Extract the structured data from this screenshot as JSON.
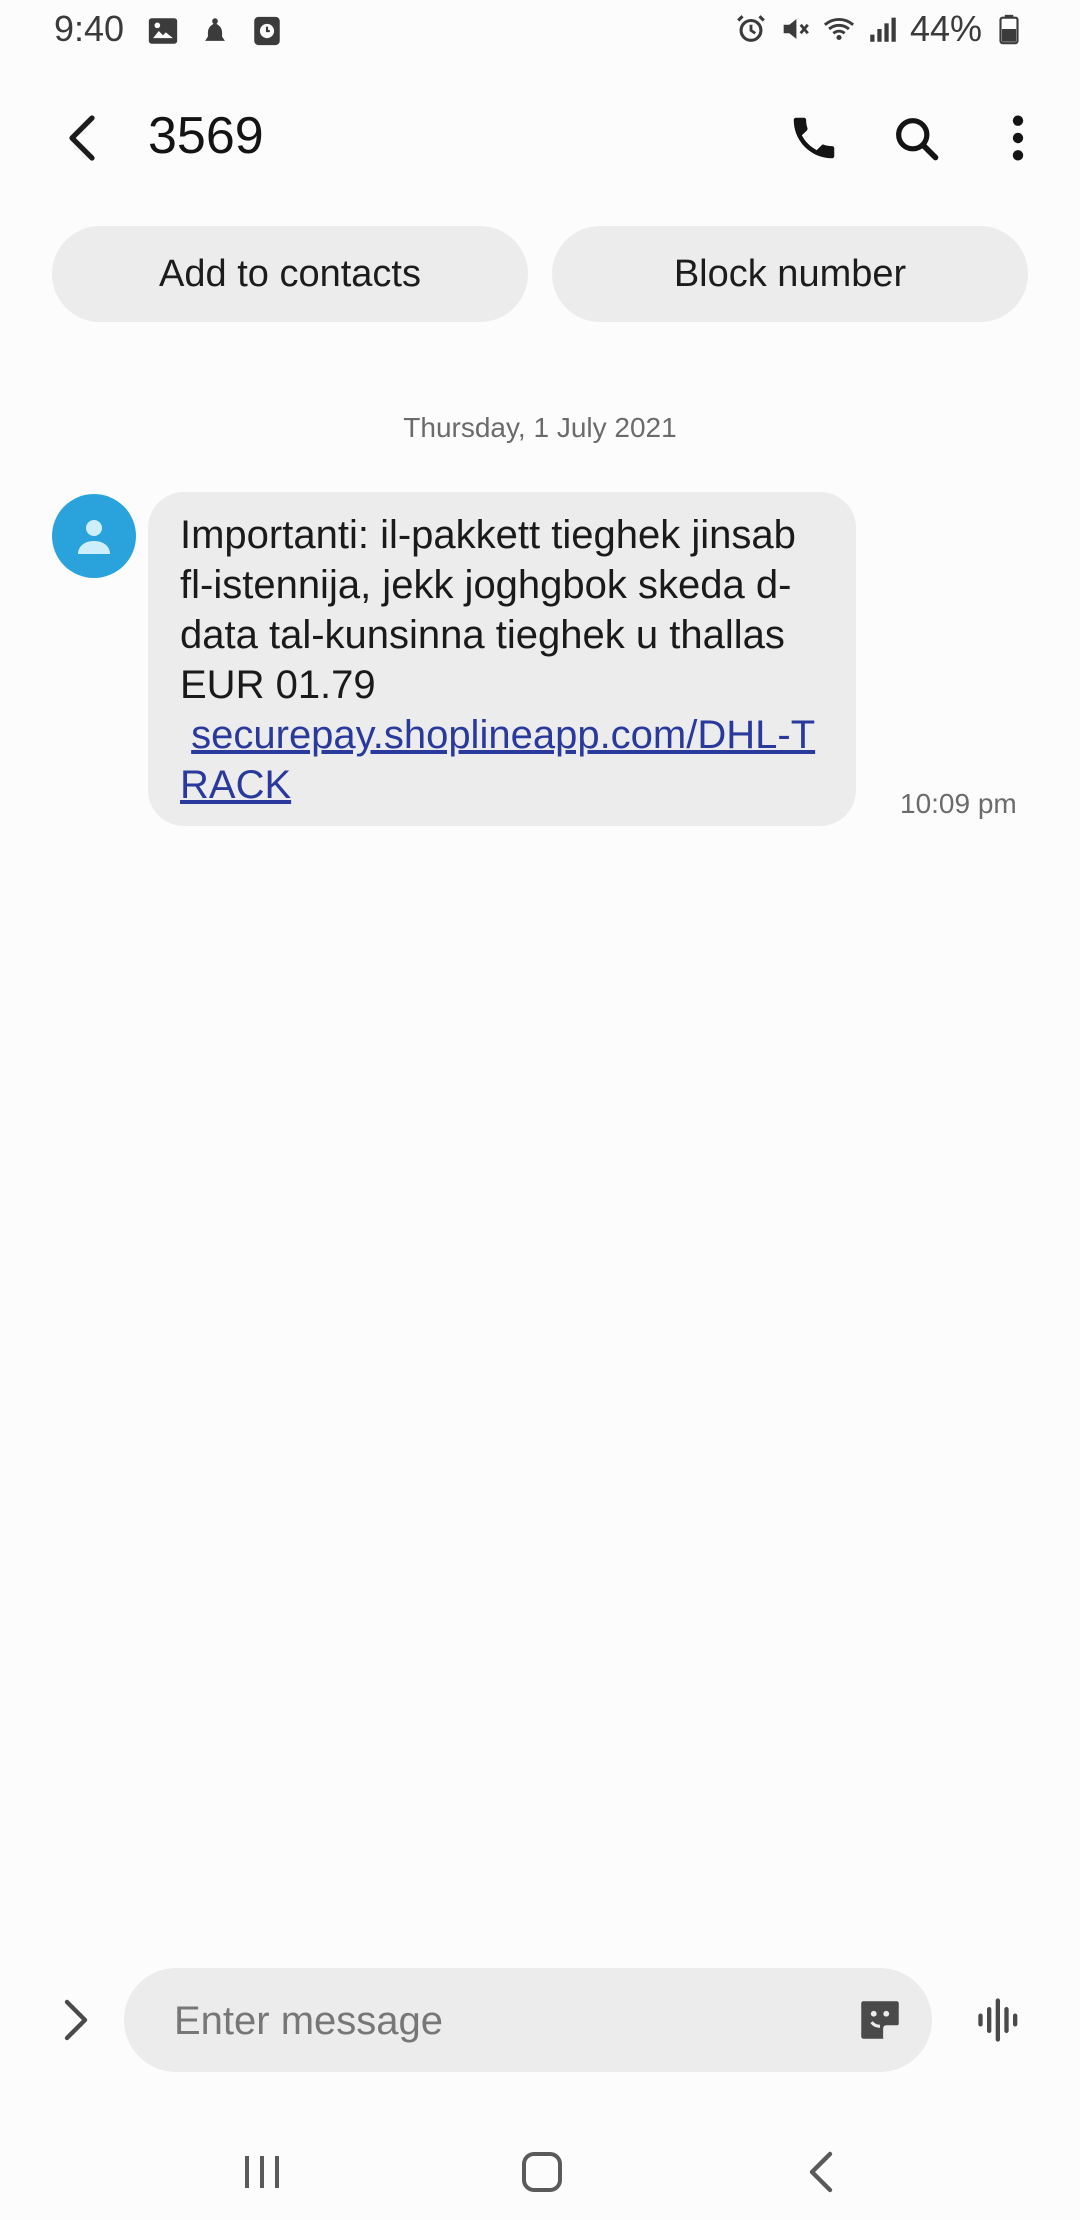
{
  "status_bar": {
    "time": "9:40",
    "battery_percent": "44%",
    "left_icons": [
      "gallery-icon",
      "notification-icon",
      "clock-app-icon"
    ],
    "right_icons": [
      "alarm-icon",
      "mute-icon",
      "wifi-icon",
      "signal-icon",
      "battery-icon"
    ]
  },
  "header": {
    "title": "3569",
    "back_icon": "back-arrow-icon",
    "actions": [
      "phone-icon",
      "search-icon",
      "more-options-icon"
    ]
  },
  "actions": {
    "add_contact_label": "Add to contacts",
    "block_label": "Block number"
  },
  "conversation": {
    "date": "Thursday, 1 July 2021",
    "messages": [
      {
        "text": "Importanti: il-pakkett tieghek jinsab fl-istennija, jekk joghgbok skeda d-data tal-kunsinna tieghek u thallas EUR 01.79",
        "link": "securepay.shoplineapp.com/​DHL-TRACK",
        "time": "10:09 pm"
      }
    ]
  },
  "composer": {
    "placeholder": "Enter message",
    "value": ""
  },
  "nav": {
    "buttons": [
      "recent-apps-icon",
      "home-icon",
      "nav-back-icon"
    ]
  },
  "colors": {
    "background": "#fcfcfc",
    "bubble": "#ececec",
    "avatar": "#2aa3dc",
    "link": "#2a3a9c"
  }
}
